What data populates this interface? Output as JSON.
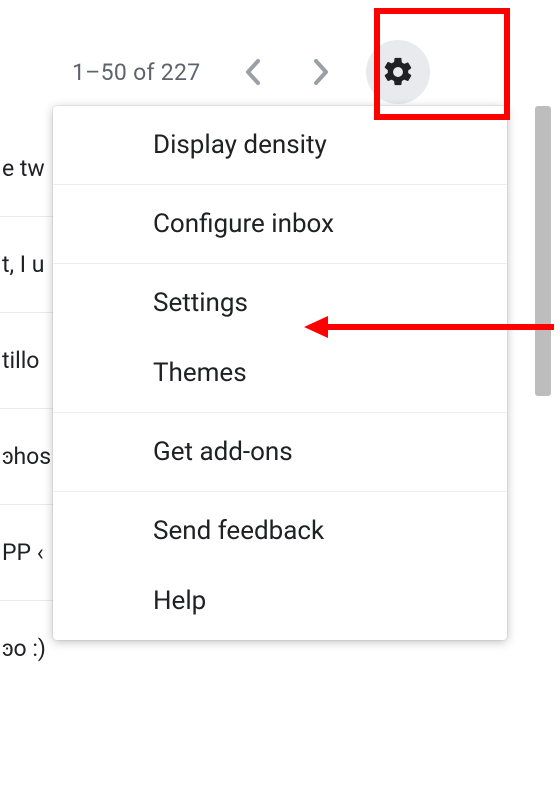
{
  "toolbar": {
    "pagination": "1–50 of 227"
  },
  "menu": {
    "items": [
      "Display density",
      "Configure inbox",
      "Settings",
      "Themes",
      "Get add-ons",
      "Send feedback",
      "Help"
    ]
  },
  "mail_fragments": [
    "e tw",
    "t, I u",
    "tillo",
    "ͽhos",
    "PP ‹",
    "ͽo :)"
  ]
}
